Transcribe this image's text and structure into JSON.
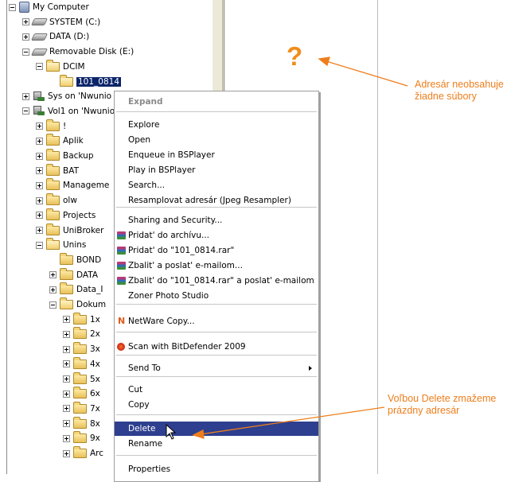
{
  "tree": {
    "items": [
      {
        "label": "My Computer",
        "icon": "computer-icon",
        "expander": "minus"
      },
      {
        "label": "SYSTEM (C:)",
        "icon": "drive-icon",
        "expander": "plus"
      },
      {
        "label": "DATA (D:)",
        "icon": "drive-icon",
        "expander": "plus"
      },
      {
        "label": "Removable Disk (E:)",
        "icon": "drive-icon",
        "expander": "minus"
      },
      {
        "label": "DCIM",
        "icon": "folder-open-icon",
        "expander": "minus"
      },
      {
        "label": "101_0814",
        "icon": "folder-open-icon",
        "expander": "none",
        "selected": true
      },
      {
        "label": "Sys on 'Nwunio",
        "icon": "network-server-icon",
        "expander": "plus"
      },
      {
        "label": "Vol1 on 'Nwunio",
        "icon": "network-server-icon",
        "expander": "minus"
      },
      {
        "label": "!",
        "icon": "folder-icon",
        "expander": "plus"
      },
      {
        "label": "Aplik",
        "icon": "folder-icon",
        "expander": "plus"
      },
      {
        "label": "Backup",
        "icon": "folder-icon",
        "expander": "plus"
      },
      {
        "label": "BAT",
        "icon": "folder-icon",
        "expander": "plus"
      },
      {
        "label": "Manageme",
        "icon": "folder-icon",
        "expander": "plus"
      },
      {
        "label": "olw",
        "icon": "folder-icon",
        "expander": "plus"
      },
      {
        "label": "Projects",
        "icon": "folder-icon",
        "expander": "plus"
      },
      {
        "label": "UniBroker",
        "icon": "folder-icon",
        "expander": "plus"
      },
      {
        "label": "Unins",
        "icon": "folder-open-icon",
        "expander": "minus"
      },
      {
        "label": "BOND",
        "icon": "folder-icon",
        "expander": "none"
      },
      {
        "label": "DATA",
        "icon": "folder-icon",
        "expander": "plus"
      },
      {
        "label": "Data_I",
        "icon": "folder-icon",
        "expander": "plus"
      },
      {
        "label": "Dokum",
        "icon": "folder-open-icon",
        "expander": "minus"
      },
      {
        "label": "1x",
        "icon": "folder-icon",
        "expander": "plus"
      },
      {
        "label": "2x",
        "icon": "folder-icon",
        "expander": "plus"
      },
      {
        "label": "3x",
        "icon": "folder-icon",
        "expander": "plus"
      },
      {
        "label": "4x",
        "icon": "folder-icon",
        "expander": "plus"
      },
      {
        "label": "5x",
        "icon": "folder-icon",
        "expander": "plus"
      },
      {
        "label": "6x",
        "icon": "folder-icon",
        "expander": "plus"
      },
      {
        "label": "7x",
        "icon": "folder-icon",
        "expander": "plus"
      },
      {
        "label": "8x",
        "icon": "folder-icon",
        "expander": "plus"
      },
      {
        "label": "9x",
        "icon": "folder-icon",
        "expander": "plus"
      },
      {
        "label": "Arc",
        "icon": "folder-icon",
        "expander": "plus"
      }
    ]
  },
  "context_menu": {
    "items": [
      {
        "label": "Expand",
        "state": "disabled"
      },
      {
        "label": "Explore"
      },
      {
        "label": "Open"
      },
      {
        "label": "Enqueue in BSPlayer"
      },
      {
        "label": "Play in BSPlayer"
      },
      {
        "label": "Search..."
      },
      {
        "label": "Resamplovat adresár (Jpeg Resampler)"
      },
      {
        "label": "Sharing and Security..."
      },
      {
        "label": "Pridat' do archívu...",
        "icon": "winrar-icon"
      },
      {
        "label": "Pridat' do \"101_0814.rar\"",
        "icon": "winrar-icon"
      },
      {
        "label": "Zbalit' a poslat' e-mailom...",
        "icon": "winrar-icon"
      },
      {
        "label": "Zbalit' do \"101_0814.rar\" a poslat' e-mailom",
        "icon": "winrar-icon"
      },
      {
        "label": "Zoner Photo Studio"
      },
      {
        "label": "NetWare Copy...",
        "icon": "netware-icon"
      },
      {
        "label": "Scan with BitDefender 2009",
        "icon": "bitdefender-icon"
      },
      {
        "label": "Send To",
        "submenu": true
      },
      {
        "label": "Cut"
      },
      {
        "label": "Copy"
      },
      {
        "label": "Delete",
        "state": "highlighted"
      },
      {
        "label": "Rename"
      },
      {
        "label": "Properties"
      }
    ]
  },
  "annotations": {
    "question_mark": "?",
    "note_empty": [
      "Adresár neobsahuje",
      "žiadne súbory"
    ],
    "note_delete": [
      "Voľbou Delete zmažeme",
      "prázdny adresár"
    ]
  },
  "colors": {
    "annotation": "#ee7e1c",
    "selection": "#0a246a",
    "menu_highlight": "#2d3f8e"
  }
}
